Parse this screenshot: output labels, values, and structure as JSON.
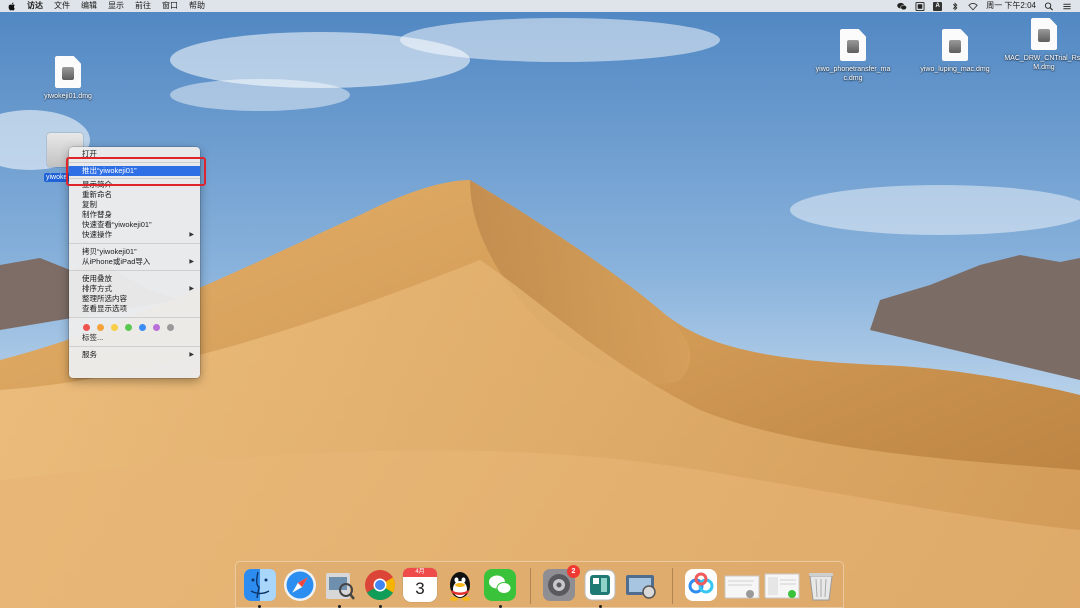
{
  "menubar": {
    "app_name": "访达",
    "menus": [
      "文件",
      "编辑",
      "显示",
      "前往",
      "窗口",
      "帮助"
    ],
    "input_a_label": "A",
    "clock": "周一 下午2:04",
    "status_icons": [
      "wechat-icon",
      "input-method-icon",
      "keyboard-a-icon",
      "bluetooth-icon",
      "wifi-icon",
      "search-icon",
      "control-center-icon"
    ]
  },
  "desktop": {
    "icons": [
      {
        "label": "yiwokeji01.dmg"
      },
      {
        "label": "yiwo_phonetransfer_mac.dmg"
      },
      {
        "label": "yiwo_luping_mac.dmg"
      },
      {
        "label": "MAC_DRW_CNTrial_RssM.dmg"
      }
    ],
    "drive_label": "yiwoke"
  },
  "context_menu": {
    "items": [
      {
        "label": "打开"
      },
      {
        "label": "推出“yiwokeji01”"
      },
      {
        "label": "显示简介"
      },
      {
        "label": "重新命名"
      },
      {
        "label": "复制"
      },
      {
        "label": "制作替身"
      },
      {
        "label": "快速查看“yiwokeji01”"
      },
      {
        "label": "快速操作"
      },
      {
        "label": "拷贝“yiwokeji01”"
      },
      {
        "label": "从iPhone或iPad导入"
      },
      {
        "label": "使用叠放"
      },
      {
        "label": "排序方式"
      },
      {
        "label": "整理所选内容"
      },
      {
        "label": "查看显示选项"
      },
      {
        "label": "标签..."
      },
      {
        "label": "服务"
      }
    ],
    "submenu_arrow": "▶",
    "tag_colors": [
      "#f0524f",
      "#f5a13c",
      "#f7ce46",
      "#5bc650",
      "#3d8cf5",
      "#b96ed8",
      "#9a9a9a"
    ]
  },
  "dock": {
    "apps": [
      "finder-icon",
      "safari-icon",
      "preview-icon",
      "chrome-icon",
      "calendar-icon",
      "qq-icon",
      "wechat-icon",
      "system-preferences-icon",
      "screen-tool-icon",
      "image-capture-icon",
      "baidu-netdisk-icon",
      "document-stack-icon",
      "document-stack-2-icon",
      "trash-icon"
    ],
    "calendar_month": "4月",
    "calendar_day": "3",
    "badge_count": "2"
  },
  "colors": {
    "menu_selection": "#2f6fe6",
    "highlight_box": "#e0242b",
    "badge": "#ee3a33"
  }
}
